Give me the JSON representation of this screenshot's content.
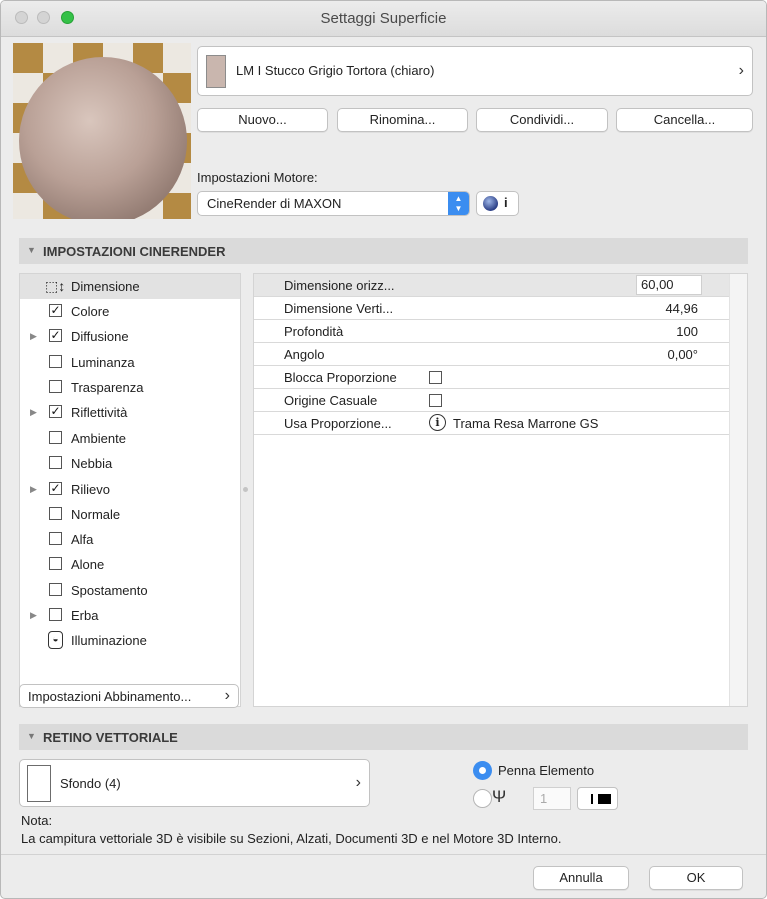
{
  "window": {
    "title": "Settaggi Superficie"
  },
  "surface": {
    "name": "LM I Stucco Grigio Tortora (chiaro)",
    "swatch_color": "#c9b6ae"
  },
  "buttons": {
    "new": "Nuovo...",
    "rename": "Rinomina...",
    "share": "Condividi...",
    "delete": "Cancella..."
  },
  "engine": {
    "label": "Impostazioni Motore:",
    "value": "CineRender di MAXON",
    "info_letter": "i"
  },
  "sections": {
    "cinerender": "IMPOSTAZIONI CINERENDER",
    "vector": "RETINO VETTORIALE"
  },
  "channels": [
    {
      "label": "Dimensione",
      "kind": "dimension",
      "checked": null,
      "expandable": false,
      "selected": true
    },
    {
      "label": "Colore",
      "kind": "checkbox",
      "checked": true,
      "expandable": false
    },
    {
      "label": "Diffusione",
      "kind": "checkbox",
      "checked": true,
      "expandable": true
    },
    {
      "label": "Luminanza",
      "kind": "checkbox",
      "checked": false,
      "expandable": false
    },
    {
      "label": "Trasparenza",
      "kind": "checkbox",
      "checked": false,
      "expandable": false
    },
    {
      "label": "Riflettività",
      "kind": "checkbox",
      "checked": true,
      "expandable": true
    },
    {
      "label": "Ambiente",
      "kind": "checkbox",
      "checked": false,
      "expandable": false
    },
    {
      "label": "Nebbia",
      "kind": "checkbox",
      "checked": false,
      "expandable": false
    },
    {
      "label": "Rilievo",
      "kind": "checkbox",
      "checked": true,
      "expandable": true
    },
    {
      "label": "Normale",
      "kind": "checkbox",
      "checked": false,
      "expandable": false
    },
    {
      "label": "Alfa",
      "kind": "checkbox",
      "checked": false,
      "expandable": false
    },
    {
      "label": "Alone",
      "kind": "checkbox",
      "checked": false,
      "expandable": false
    },
    {
      "label": "Spostamento",
      "kind": "checkbox",
      "checked": false,
      "expandable": false
    },
    {
      "label": "Erba",
      "kind": "checkbox",
      "checked": false,
      "expandable": true
    },
    {
      "label": "Illuminazione",
      "kind": "illumination",
      "checked": null,
      "expandable": false
    }
  ],
  "matching_button": "Impostazioni Abbinamento...",
  "properties": {
    "width": {
      "name": "Dimensione orizz...",
      "value": "60,00"
    },
    "height": {
      "name": "Dimensione Verti...",
      "value": "44,96"
    },
    "depth": {
      "name": "Profondità",
      "value": "100"
    },
    "angle": {
      "name": "Angolo",
      "value": "0,00°"
    },
    "lock_ratio": {
      "name": "Blocca Proporzione",
      "checked": false
    },
    "random_origin": {
      "name": "Origine Casuale",
      "checked": false
    },
    "use_ratio": {
      "name": "Usa Proporzione...",
      "value": "Trama Resa Marrone GS"
    }
  },
  "vector_fill": {
    "name": "Sfondo (4)",
    "pen_option_label": "Penna Elemento",
    "pen_number": "1",
    "selected_option": "element-pen"
  },
  "note": {
    "title": "Nota:",
    "text": "La campitura vettoriale 3D è visibile su Sezioni, Alzati, Documenti 3D e nel Motore 3D Interno."
  },
  "footer": {
    "cancel": "Annulla",
    "ok": "OK"
  },
  "colors": {
    "accent": "#3b8df0",
    "maximize": "#35c148",
    "panel_bg": "#ececec",
    "section_header": "#dadada"
  },
  "icons": {
    "chevron": "chevron-right-icon",
    "stepper": "stepper-icon",
    "cinerender": "cinerender-sphere-icon",
    "dimension": "dimension-icon",
    "illumination": "light-bulb-icon",
    "info": "info-icon",
    "pen": "pen-icon"
  }
}
